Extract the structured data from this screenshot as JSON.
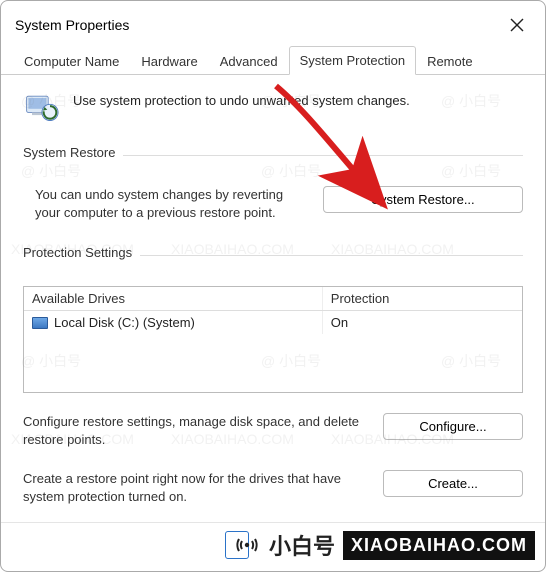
{
  "window": {
    "title": "System Properties"
  },
  "tabs": [
    {
      "label": "Computer Name",
      "active": false
    },
    {
      "label": "Hardware",
      "active": false
    },
    {
      "label": "Advanced",
      "active": false
    },
    {
      "label": "System Protection",
      "active": true
    },
    {
      "label": "Remote",
      "active": false
    }
  ],
  "intro": {
    "text": "Use system protection to undo unwanted system changes."
  },
  "system_restore": {
    "heading": "System Restore",
    "desc": "You can undo system changes by reverting your computer to a previous restore point.",
    "button": "System Restore..."
  },
  "protection_settings": {
    "heading": "Protection Settings",
    "col_drives": "Available Drives",
    "col_protection": "Protection",
    "rows": [
      {
        "drive": "Local Disk (C:) (System)",
        "protection": "On"
      }
    ],
    "configure_desc": "Configure restore settings, manage disk space, and delete restore points.",
    "configure_button": "Configure...",
    "create_desc": "Create a restore point right now for the drives that have system protection turned on.",
    "create_button": "Create..."
  },
  "watermark": {
    "cn": "小白号",
    "domain": "XIAOBAIHAO.COM",
    "tag": "@ 小白号"
  }
}
